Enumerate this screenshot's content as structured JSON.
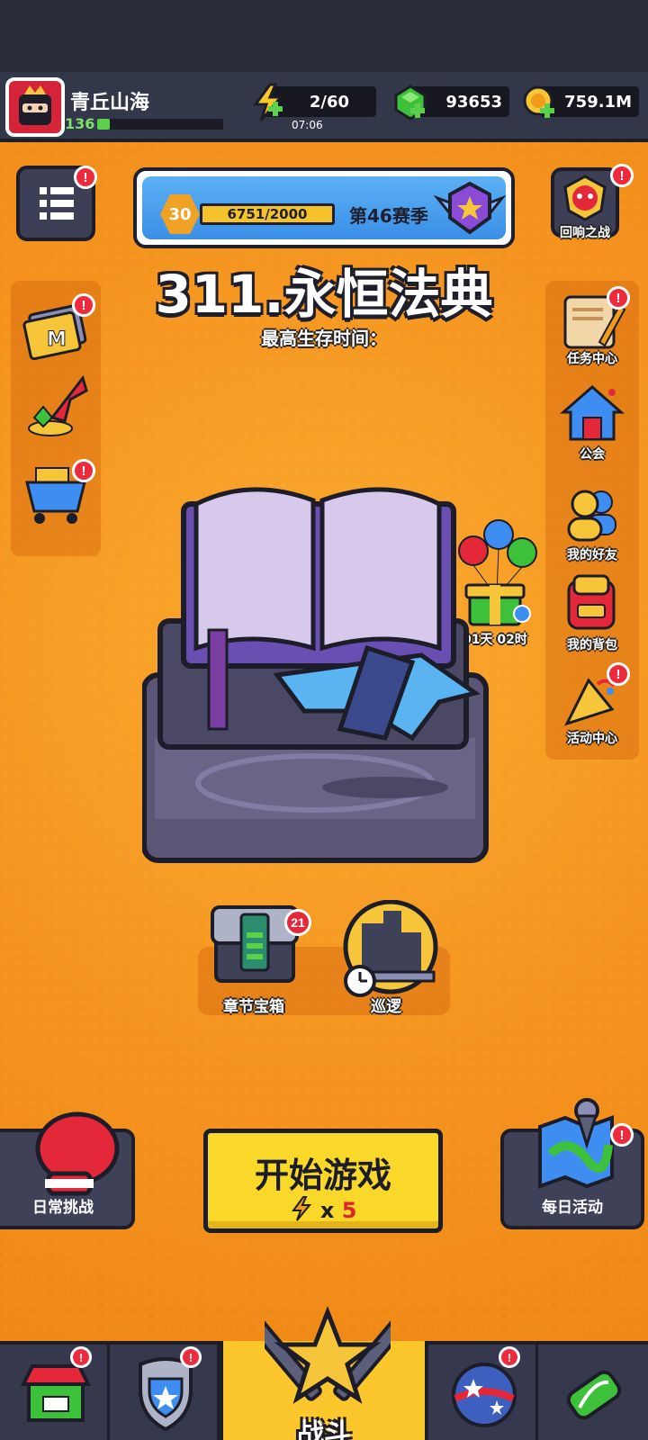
{
  "player": {
    "name": "青丘山海",
    "level": "136",
    "level_progress": 0.1
  },
  "resources": {
    "energy": "2/60",
    "energy_timer": "07:06",
    "gems": "93653",
    "coins": "759.1M"
  },
  "season": {
    "level": "30",
    "progress": "6751/2000",
    "name": "第46赛季"
  },
  "chapter": {
    "title": "311.永恒法典",
    "survival_label": "最高生存时间："
  },
  "right_menu": {
    "echo_battle": "回响之战",
    "tasks": "任务中心",
    "guild": "公会",
    "friends": "我的好友",
    "backpack": "我的背包",
    "events": "活动中心"
  },
  "gift_timer": "01天 02时",
  "chest": {
    "label": "章节宝箱",
    "count": "21"
  },
  "patrol": {
    "label": "巡逻"
  },
  "buttons": {
    "daily_challenge": "日常挑战",
    "start": "开始游戏",
    "start_cost_x": "x",
    "start_cost_n": "5",
    "daily_event": "每日活动"
  },
  "nav": {
    "battle": "战斗"
  },
  "badge_mark": "!",
  "colors": {
    "accent": "#f9d82a",
    "badge": "#ee2b3c",
    "background": "#f08f14"
  }
}
